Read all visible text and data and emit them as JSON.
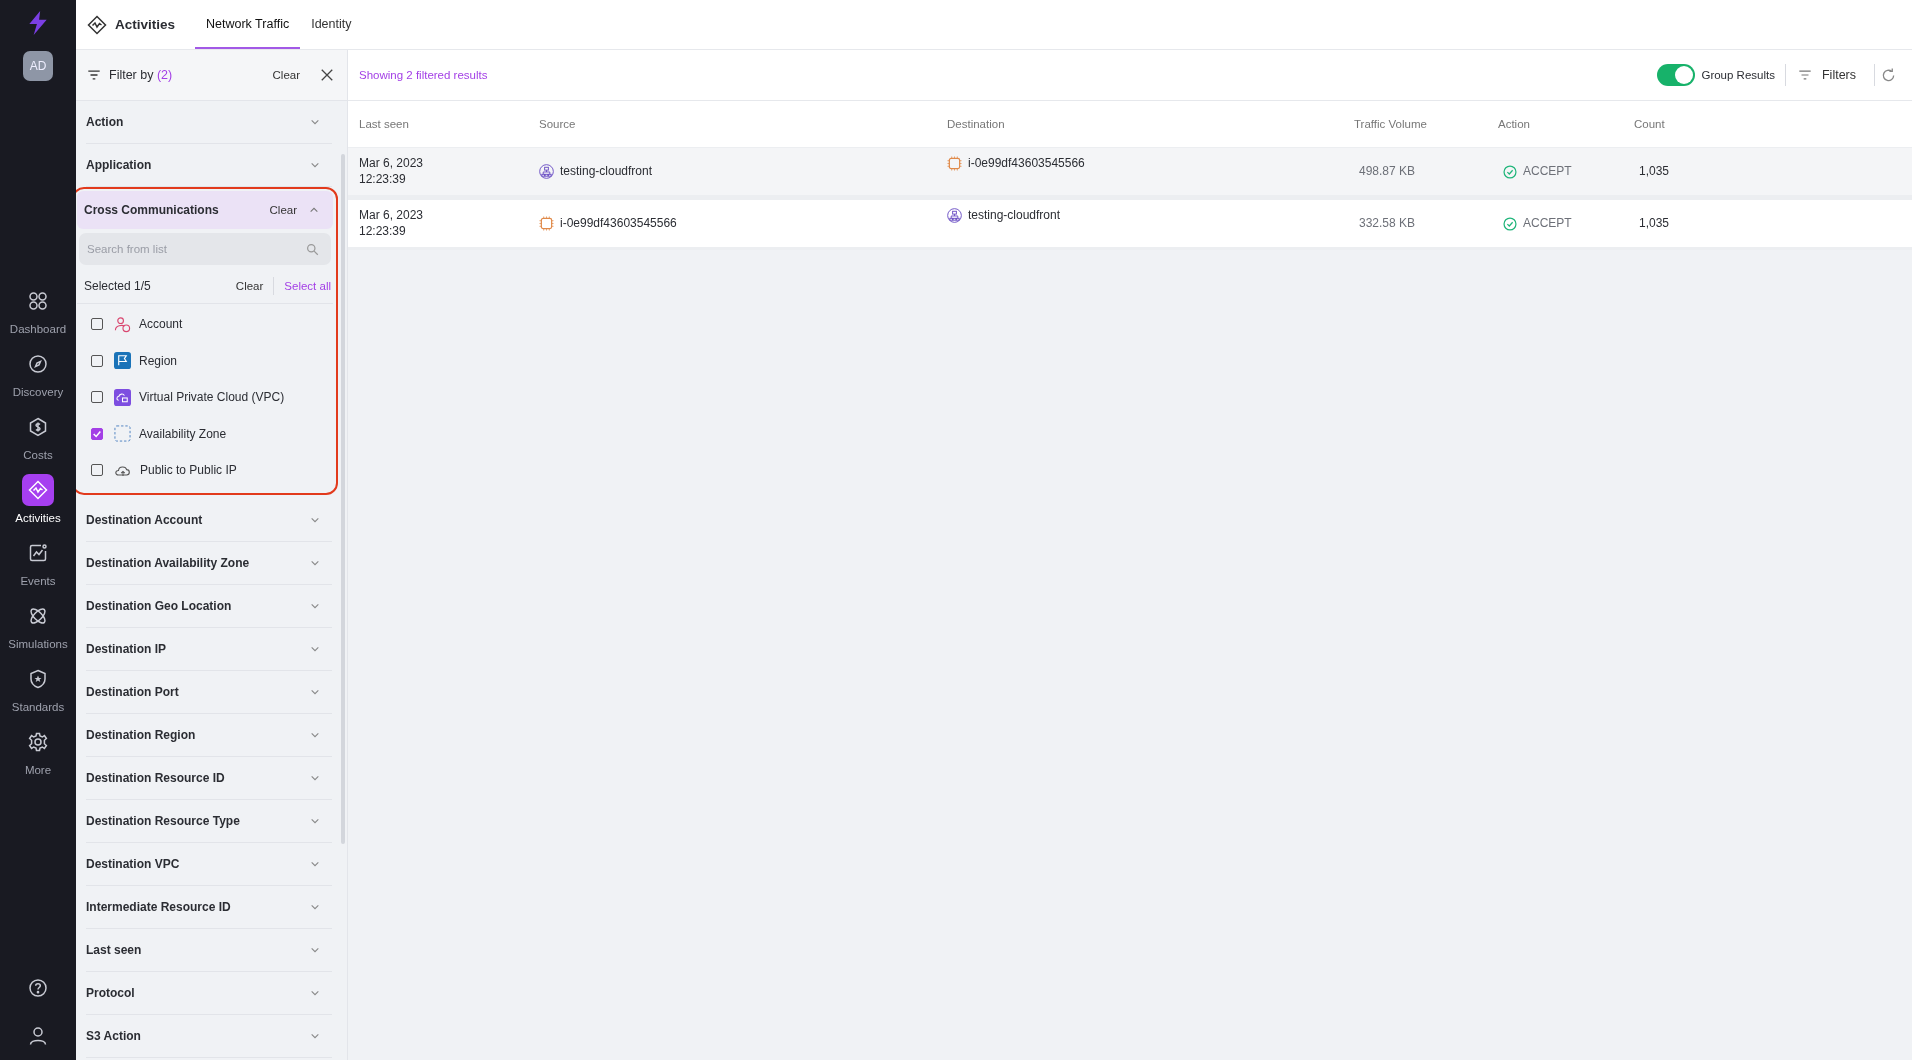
{
  "nav": {
    "avatar": "AD",
    "items": [
      {
        "label": "Dashboard",
        "kind": "grid",
        "selected": false
      },
      {
        "label": "Discovery",
        "kind": "compass",
        "selected": false
      },
      {
        "label": "Costs",
        "kind": "dollar",
        "selected": false
      },
      {
        "label": "Activities",
        "kind": "activity",
        "selected": true
      },
      {
        "label": "Events",
        "kind": "chart",
        "selected": false
      },
      {
        "label": "Simulations",
        "kind": "atom",
        "selected": false
      },
      {
        "label": "Standards",
        "kind": "shield",
        "selected": false
      },
      {
        "label": "More",
        "kind": "gear",
        "selected": false
      }
    ]
  },
  "header": {
    "title": "Activities",
    "tabs": [
      {
        "label": "Network Traffic",
        "selected": true
      },
      {
        "label": "Identity",
        "selected": false
      }
    ]
  },
  "filter_panel": {
    "title": "Filter by",
    "count": "(2)",
    "clear": "Clear",
    "sections": [
      {
        "label": "Action",
        "expanded": false
      },
      {
        "label": "Application",
        "expanded": false
      },
      {
        "label": "Cross Communications",
        "expanded": true,
        "highlighted": true,
        "clear": "Clear",
        "search_placeholder": "Search from list",
        "selected_text": "Selected 1/5",
        "clear_selection": "Clear",
        "select_all": "Select all",
        "options": [
          {
            "label": "Account",
            "kind": "account",
            "checked": false
          },
          {
            "label": "Region",
            "kind": "region",
            "checked": false
          },
          {
            "label": "Virtual Private Cloud (VPC)",
            "kind": "vpc",
            "checked": false
          },
          {
            "label": "Availability Zone",
            "kind": "zone",
            "checked": true
          },
          {
            "label": "Public to Public IP",
            "kind": "cloud",
            "checked": false
          }
        ]
      },
      {
        "label": "Destination Account",
        "expanded": false
      },
      {
        "label": "Destination Availability Zone",
        "expanded": false
      },
      {
        "label": "Destination Geo Location",
        "expanded": false
      },
      {
        "label": "Destination IP",
        "expanded": false
      },
      {
        "label": "Destination Port",
        "expanded": false
      },
      {
        "label": "Destination Region",
        "expanded": false
      },
      {
        "label": "Destination Resource ID",
        "expanded": false
      },
      {
        "label": "Destination Resource Type",
        "expanded": false
      },
      {
        "label": "Destination VPC",
        "expanded": false
      },
      {
        "label": "Intermediate Resource ID",
        "expanded": false
      },
      {
        "label": "Last seen",
        "expanded": false
      },
      {
        "label": "Protocol",
        "expanded": false
      },
      {
        "label": "S3 Action",
        "expanded": false
      }
    ]
  },
  "results": {
    "summary": "Showing 2 filtered results",
    "group_results": {
      "label": "Group Results",
      "on": true
    },
    "filters": "Filters"
  },
  "table": {
    "columns": [
      "Last seen",
      "Source",
      "Destination",
      "Traffic Volume",
      "Action",
      "Count"
    ],
    "rows": [
      {
        "date": "Mar 6, 2023",
        "time": "12:23:39",
        "source": {
          "text": "testing-cloudfront",
          "kind": "cloudfront"
        },
        "destination": {
          "text": "i-0e99df43603545566",
          "kind": "instance"
        },
        "traffic": "498.87 KB",
        "action": "ACCEPT",
        "count": "1,035"
      },
      {
        "date": "Mar 6, 2023",
        "time": "12:23:39",
        "source": {
          "text": "i-0e99df43603545566",
          "kind": "instance"
        },
        "destination": {
          "text": "testing-cloudfront",
          "kind": "cloudfront"
        },
        "traffic": "332.58 KB",
        "action": "ACCEPT",
        "count": "1,035"
      }
    ]
  }
}
